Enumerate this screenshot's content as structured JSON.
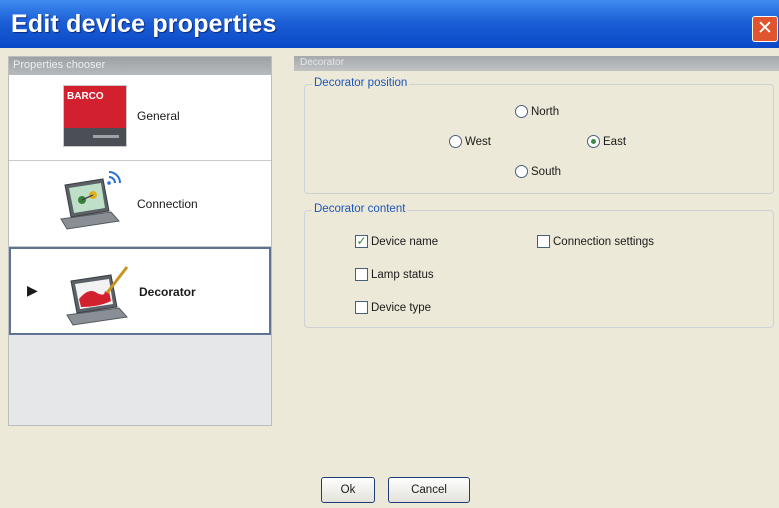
{
  "window": {
    "title": "Edit device properties",
    "close_glyph": "✕"
  },
  "left": {
    "header": "Properties chooser",
    "items": [
      {
        "label": "General",
        "icon": "barco-logo-icon",
        "logo_text": "BARCO"
      },
      {
        "label": "Connection",
        "icon": "laptop-wireless-icon"
      },
      {
        "label": "Decorator",
        "icon": "laptop-brush-icon",
        "selected": true,
        "arrow": "▶"
      }
    ]
  },
  "right": {
    "header": "Decorator",
    "position_group": {
      "label": "Decorator position",
      "options": {
        "north": "North",
        "west": "West",
        "east": "East",
        "south": "South"
      },
      "selected": "East"
    },
    "content_group": {
      "label": "Decorator content",
      "device_name": {
        "label": "Device name",
        "checked": true
      },
      "connection_settings": {
        "label": "Connection settings",
        "checked": false
      },
      "lamp_status": {
        "label": "Lamp status",
        "checked": false
      },
      "device_type": {
        "label": "Device type",
        "checked": false
      }
    }
  },
  "buttons": {
    "ok": "Ok",
    "cancel": "Cancel"
  },
  "colors": {
    "title_bar": "#1c5fd6",
    "close": "#e0552d",
    "group_label": "#1d55b8",
    "barco_red": "#d3202f"
  }
}
